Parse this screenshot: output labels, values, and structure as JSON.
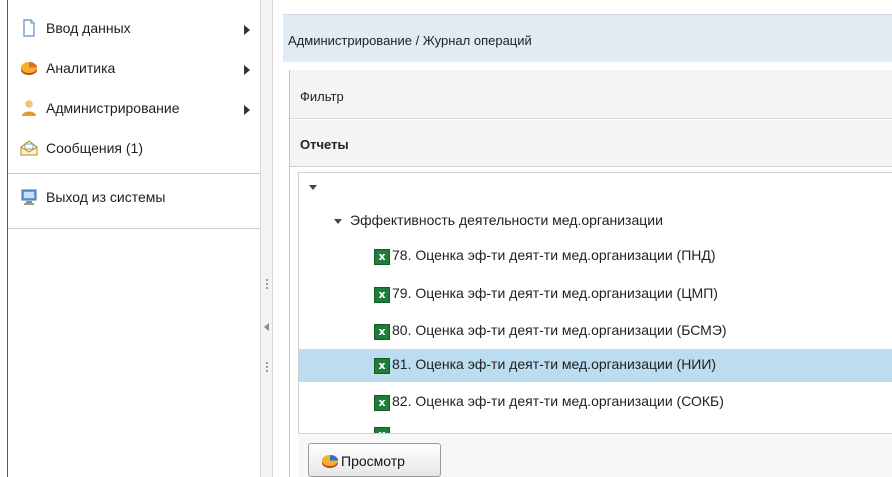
{
  "sidebar": {
    "items": [
      {
        "label": "Ввод данных",
        "icon": "document-icon",
        "has_submenu": true
      },
      {
        "label": "Аналитика",
        "icon": "pie-chart-icon",
        "has_submenu": true
      },
      {
        "label": "Администрирование",
        "icon": "user-icon",
        "has_submenu": true
      },
      {
        "label": "Сообщения (1)",
        "icon": "envelope-icon",
        "has_submenu": false
      },
      {
        "label": "Выход из системы",
        "icon": "computer-icon",
        "has_submenu": false
      }
    ]
  },
  "breadcrumb": "Администрирование / Журнал операций",
  "panels": {
    "filter_label": "Фильтр",
    "reports_label": "Отчеты"
  },
  "tree": {
    "group_label": "Эффективность деятельности мед.организации",
    "items": [
      {
        "label": "78. Оценка эф-ти деят-ти мед.организации (ПНД)",
        "selected": false
      },
      {
        "label": "79. Оценка эф-ти деят-ти мед.организации (ЦМП)",
        "selected": false
      },
      {
        "label": "80. Оценка эф-ти деят-ти мед.организации (БСМЭ)",
        "selected": false
      },
      {
        "label": "81. Оценка эф-ти деят-ти мед.организации (НИИ)",
        "selected": true
      },
      {
        "label": "82. Оценка эф-ти деят-ти мед.организации (СОКБ)",
        "selected": false
      }
    ],
    "selected_color": "#bcdcef"
  },
  "actions": {
    "view_label": "Просмотр"
  },
  "colors": {
    "breadcrumb_bg": "#e2ebf3",
    "excel_green": "#1f7d3b"
  }
}
